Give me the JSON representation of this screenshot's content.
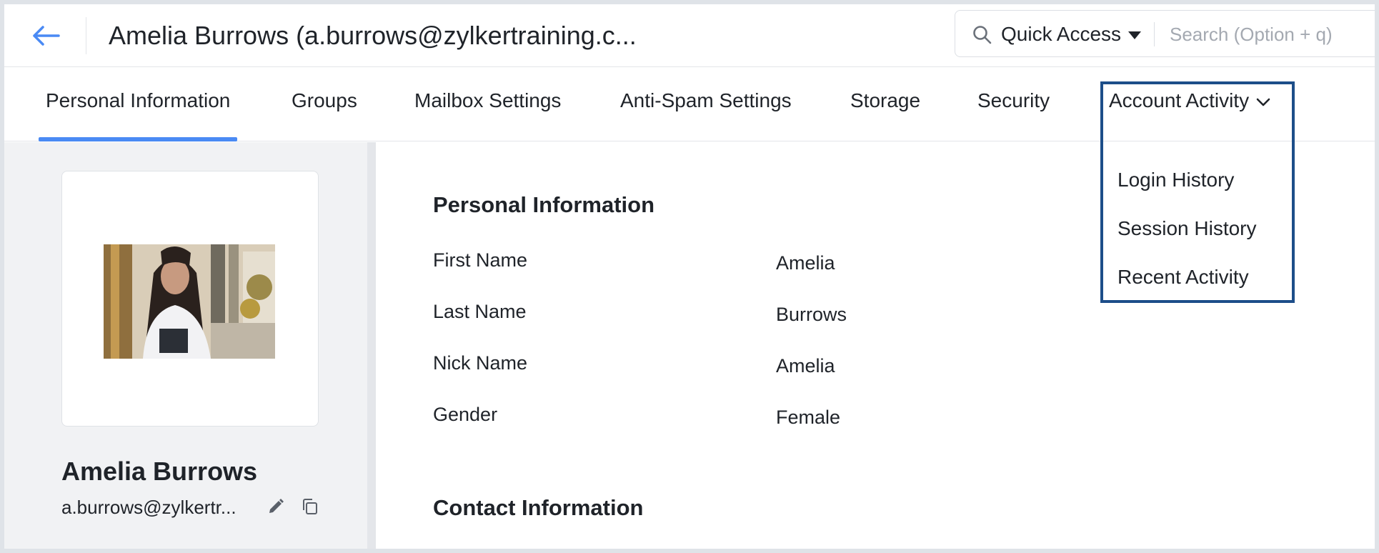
{
  "header": {
    "title": "Amelia Burrows (a.burrows@zylkertraining.c...",
    "quick_access_label": "Quick Access",
    "search_placeholder": "Search (Option + q)",
    "accent_color": "#4a8af4"
  },
  "tabs": [
    {
      "label": "Personal Information",
      "active": true
    },
    {
      "label": "Groups"
    },
    {
      "label": "Mailbox Settings"
    },
    {
      "label": "Anti-Spam Settings"
    },
    {
      "label": "Storage"
    },
    {
      "label": "Security"
    },
    {
      "label": "Account Activity",
      "has_dropdown": true
    }
  ],
  "account_activity_menu": {
    "items": [
      "Login History",
      "Session History",
      "Recent Activity"
    ],
    "highlight_color": "#1d4e89"
  },
  "profile": {
    "name": "Amelia Burrows",
    "email": "a.burrows@zylkertr..."
  },
  "personal_info": {
    "title": "Personal Information",
    "fields": [
      {
        "label": "First Name",
        "value": "Amelia"
      },
      {
        "label": "Last Name",
        "value": "Burrows"
      },
      {
        "label": "Nick Name",
        "value": "Amelia"
      },
      {
        "label": "Gender",
        "value": "Female"
      }
    ]
  },
  "contact_info": {
    "title": "Contact Information"
  }
}
